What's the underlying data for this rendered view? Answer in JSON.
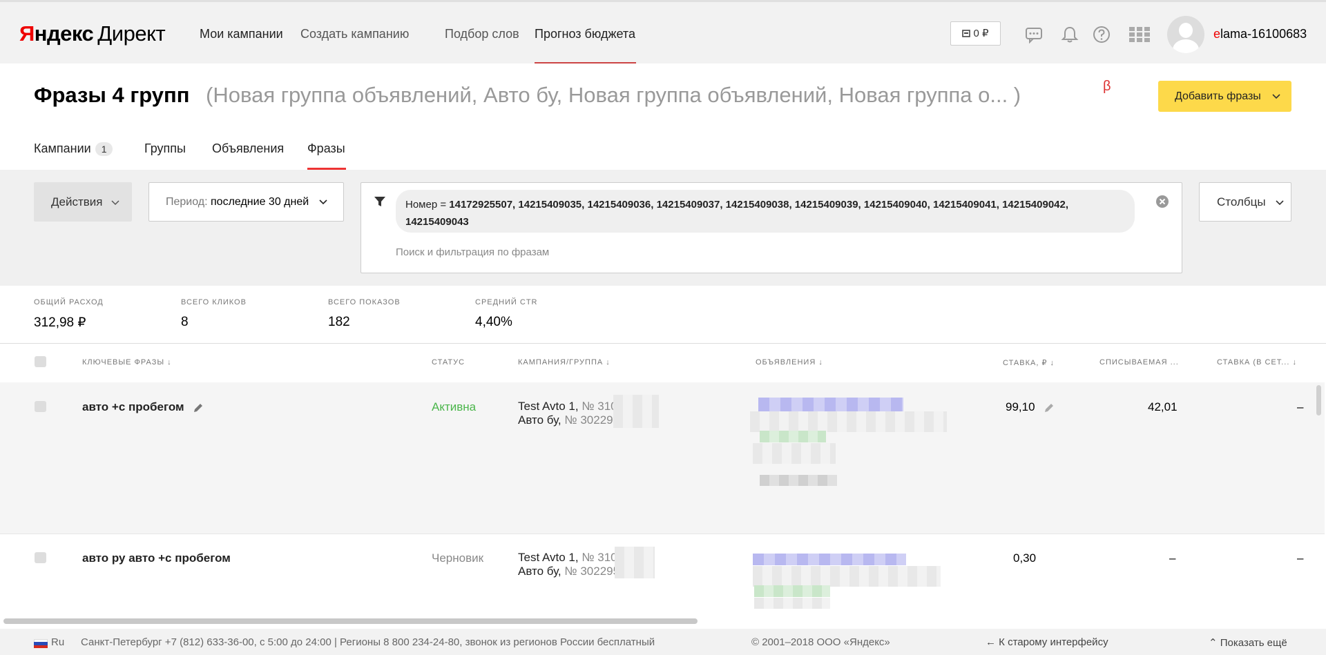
{
  "header": {
    "logo_ya": "Я",
    "logo_ndex": "ндекс",
    "logo_direct": "Директ",
    "nav": [
      "Мои кампании",
      "Создать кампанию",
      "Подбор слов",
      "Прогноз бюджета"
    ],
    "balance": "0 ₽",
    "login_first": "e",
    "login_rest": "lama-16100683"
  },
  "title": {
    "main": "Фразы 4 групп",
    "subtitle": "(Новая группа объявлений, Авто бу, Новая группа объявлений, Новая группа о...  )",
    "beta": "β",
    "add_button": "Добавить фразы"
  },
  "tabs": [
    {
      "label": "Кампании",
      "badge": "1"
    },
    {
      "label": "Группы"
    },
    {
      "label": "Объявления"
    },
    {
      "label": "Фразы"
    }
  ],
  "filters": {
    "actions": "Действия",
    "period_label": "Период:",
    "period_value": "последние 30 дней",
    "chip_label": "Номер =",
    "chip_value": "14172925507, 14215409035, 14215409036, 14215409037, 14215409038, 14215409039, 14215409040, 14215409041, 14215409042, 14215409043",
    "search_placeholder": "Поиск и фильтрация по фразам",
    "columns": "Столбцы"
  },
  "stats": [
    {
      "label": "ОБЩИЙ РАСХОД",
      "value": "312,98 ₽"
    },
    {
      "label": "ВСЕГО КЛИКОВ",
      "value": "8"
    },
    {
      "label": "ВСЕГО ПОКАЗОВ",
      "value": "182"
    },
    {
      "label": "СРЕДНИЙ CTR",
      "value": "4,40%"
    }
  ],
  "table": {
    "columns": {
      "phrases": "КЛЮЧЕВЫЕ ФРАЗЫ",
      "status": "СТАТУС",
      "campaign": "КАМПАНИЯ/ГРУППА",
      "ads": "ОБЪЯВЛЕНИЯ",
      "bid": "СТАВКА, ₽",
      "charged": "СПИСЫВАЕМАЯ ...",
      "bid_net": "СТАВКА (В СЕТ..."
    },
    "rows": [
      {
        "phrase": "авто +с пробегом",
        "status": "Активна",
        "campaign": "Test Avto 1,",
        "campaign_num": "№ 310",
        "group": "Авто бу,",
        "group_num": "№ 30229",
        "bid": "99,10",
        "charged": "42,01",
        "bid_net": "–"
      },
      {
        "phrase": "авто ру авто +с пробегом",
        "status": "Черновик",
        "campaign": "Test Avto 1,",
        "campaign_num": "№ 310",
        "group": "Авто бу,",
        "group_num": "№ 302295",
        "bid": "0,30",
        "charged": "–",
        "bid_net": "–"
      }
    ]
  },
  "footer": {
    "lang": "Ru",
    "contacts": "Санкт-Петербург +7 (812) 633-36-00, с 5:00 до 24:00 | Регионы 8 800 234-24-80, звонок из регионов России бесплатный",
    "copyright": "© 2001–2018 ООО «Яндекс»",
    "old_ui": "К старому интерфейсу",
    "show_more": "Показать ещё"
  },
  "colors": {
    "accent_yellow": "#fdd94a",
    "accent_red": "#e33333",
    "status_active": "#4bb64b"
  }
}
